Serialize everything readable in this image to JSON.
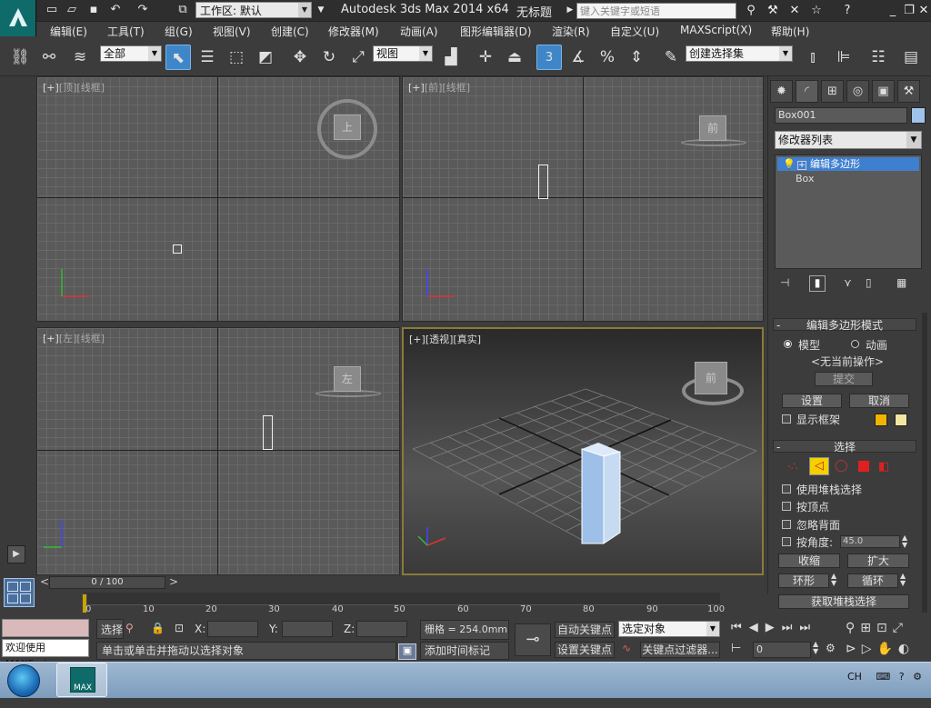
{
  "titlebar": {
    "workspace": "工作区: 默认",
    "app_title": "Autodesk 3ds Max  2014 x64",
    "doc_title": "无标题",
    "search_placeholder": "键入关键字或短语"
  },
  "menubar": {
    "items": [
      "编辑(E)",
      "工具(T)",
      "组(G)",
      "视图(V)",
      "创建(C)",
      "修改器(M)",
      "动画(A)",
      "图形编辑器(D)",
      "渲染(R)",
      "自定义(U)",
      "MAXScript(X)",
      "帮助(H)"
    ]
  },
  "toolbar": {
    "selection_filter": "全部",
    "ref_coord": "视图",
    "snap_label": "3",
    "named_selection": "创建选择集"
  },
  "viewports": {
    "top": {
      "label_plus": "[+]",
      "label_view": "[顶]",
      "label_shade": "[线框]",
      "cube": "上"
    },
    "front": {
      "label_plus": "[+]",
      "label_view": "[前]",
      "label_shade": "[线框]",
      "cube": "前"
    },
    "left": {
      "label_plus": "[+]",
      "label_view": "[左]",
      "label_shade": "[线框]",
      "cube": "左"
    },
    "persp": {
      "label_plus": "[+]",
      "label_view": "[透视]",
      "label_shade": "[真实]",
      "cube": "前"
    }
  },
  "command_panel": {
    "object_name": "Box001",
    "object_color": "#9ec4ec",
    "modifier_list": "修改器列表",
    "stack": [
      "编辑多边形",
      "Box"
    ],
    "rollout_mode": {
      "title": "编辑多边形模式",
      "radio_model": "模型",
      "radio_anim": "动画",
      "no_op": "<无当前操作>",
      "commit": "提交",
      "settings": "设置",
      "cancel": "取消",
      "show_cage": "显示框架"
    },
    "rollout_select": {
      "title": "选择",
      "use_stack": "使用堆栈选择",
      "by_vertex": "按顶点",
      "ignore_back": "忽略背面",
      "by_angle": "按角度:",
      "angle_value": "45.0",
      "shrink": "收缩",
      "grow": "扩大",
      "ring": "环形",
      "loop": "循环",
      "get_stack": "获取堆栈选择"
    }
  },
  "timeslider": {
    "text": "0 / 100"
  },
  "trackbar": {
    "ticks": [
      "0",
      "10",
      "20",
      "30",
      "40",
      "50",
      "60",
      "70",
      "80",
      "90",
      "100"
    ]
  },
  "status": {
    "maxscript_text": "欢迎使用 MAXScri",
    "select_label": "选择",
    "x_label": "X:",
    "y_label": "Y:",
    "z_label": "Z:",
    "grid": "栅格 = 254.0mm",
    "prompt": "单击或单击并拖动以选择对象",
    "add_time_tag": "添加时间标记",
    "auto_key": "自动关键点",
    "set_key": "设置关键点",
    "key_mode": "选定对象",
    "key_filters": "关键点过滤器...",
    "frame": "0"
  },
  "taskbar": {
    "lang": "CH",
    "max_label": "MAX"
  }
}
